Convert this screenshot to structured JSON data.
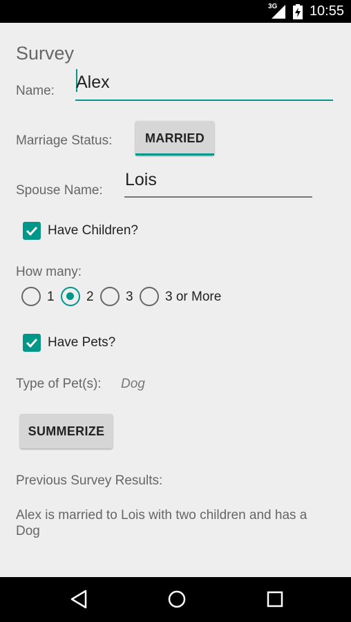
{
  "status_bar": {
    "network": "3G",
    "time": "10:55"
  },
  "form": {
    "title": "Survey",
    "name_label": "Name:",
    "name_value": "Alex",
    "marriage_label": "Marriage Status:",
    "marriage_button": "MARRIED",
    "spouse_label": "Spouse Name:",
    "spouse_value": "Lois",
    "children_checkbox_label": "Have Children?",
    "children_checked": true,
    "how_many_label": "How many:",
    "children_options": [
      "1",
      "2",
      "3",
      "3 or More"
    ],
    "children_selected": "2",
    "pets_checkbox_label": "Have Pets?",
    "pets_checked": true,
    "pet_type_label": "Type of Pet(s):",
    "pet_type_value": "Dog",
    "summarize_button": "SUMMERIZE",
    "previous_label": "Previous Survey Results:",
    "previous_result": "Alex is married to Lois with two children and has a Dog"
  },
  "colors": {
    "accent": "#009688",
    "background": "#eeeeee",
    "bars": "#000000"
  },
  "nav_bar": {
    "icons": [
      "back-icon",
      "home-icon",
      "recents-icon"
    ]
  }
}
